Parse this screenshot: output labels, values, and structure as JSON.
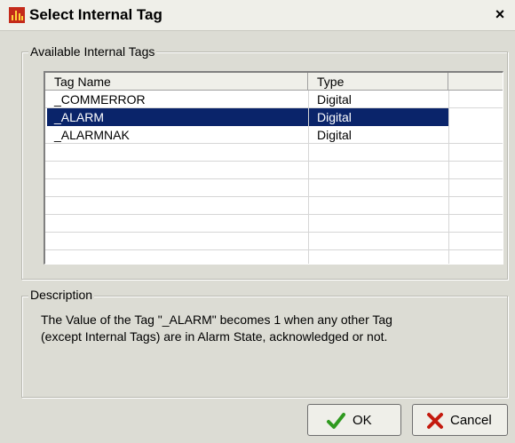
{
  "window": {
    "title": "Select Internal Tag",
    "close_glyph": "×"
  },
  "tags_group": {
    "title": "Available Internal Tags",
    "columns": [
      "Tag Name",
      "Type"
    ],
    "rows": [
      {
        "name": "_COMMERROR",
        "type": "Digital",
        "selected": false
      },
      {
        "name": "_ALARM",
        "type": "Digital",
        "selected": true
      },
      {
        "name": "_ALARMNAK",
        "type": "Digital",
        "selected": false
      }
    ]
  },
  "description_group": {
    "title": "Description",
    "text_line1": "The Value of the Tag \"_ALARM\" becomes 1 when any other Tag",
    "text_line2": "(except Internal Tags) are in Alarm State, acknowledged or not."
  },
  "buttons": {
    "ok_label": "OK",
    "cancel_label": "Cancel"
  },
  "colors": {
    "dialog_bg": "#dcdcd4",
    "selection": "#0a246a",
    "ok_icon": "#2f9a1f",
    "cancel_icon": "#c41a0e"
  },
  "icons": {
    "app": "app-tag-icon",
    "ok": "check-icon",
    "cancel": "x-icon"
  }
}
